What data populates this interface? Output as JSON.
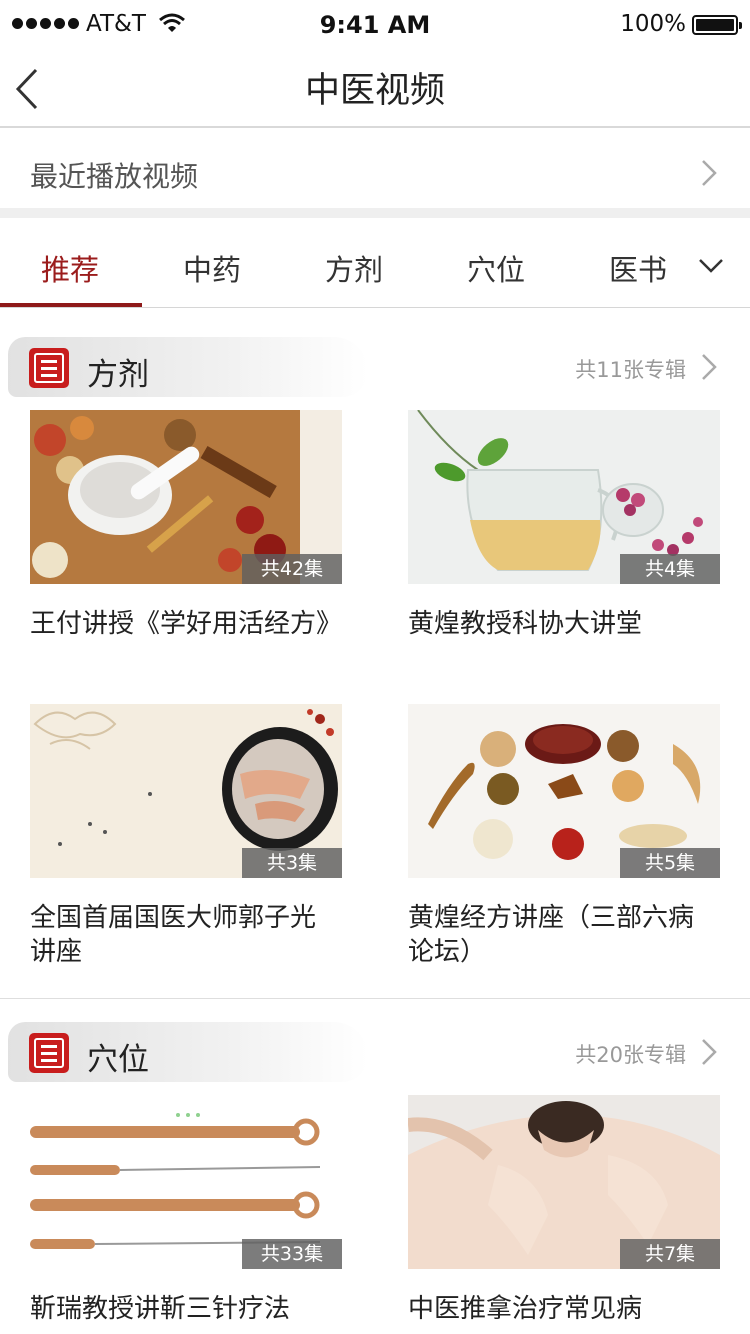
{
  "status_bar": {
    "carrier": "AT&T",
    "time": "9:41 AM",
    "battery": "100%"
  },
  "nav": {
    "title": "中医视频"
  },
  "recent": {
    "label": "最近播放视频"
  },
  "tabs": [
    {
      "label": "推荐",
      "active": true
    },
    {
      "label": "中药",
      "active": false
    },
    {
      "label": "方剂",
      "active": false
    },
    {
      "label": "穴位",
      "active": false
    },
    {
      "label": "医书",
      "active": false
    }
  ],
  "sections": [
    {
      "title": "方剂",
      "count": "共11张专辑",
      "cards": [
        {
          "title": "王付讲授《学好用活经方》",
          "episodes": "共42集"
        },
        {
          "title": "黄煌教授科协大讲堂",
          "episodes": "共4集"
        },
        {
          "title": "全国首届国医大师郭子光讲座",
          "episodes": "共3集"
        },
        {
          "title": "黄煌经方讲座（三部六病论坛）",
          "episodes": "共5集"
        }
      ]
    },
    {
      "title": "穴位",
      "count": "共20张专辑",
      "cards": [
        {
          "title": "靳瑞教授讲靳三针疗法",
          "episodes": "共33集"
        },
        {
          "title": "中医推拿治疗常见病",
          "episodes": "共7集"
        }
      ]
    }
  ],
  "colors": {
    "accent": "#8e1a1a",
    "seal": "#c81d1d"
  }
}
